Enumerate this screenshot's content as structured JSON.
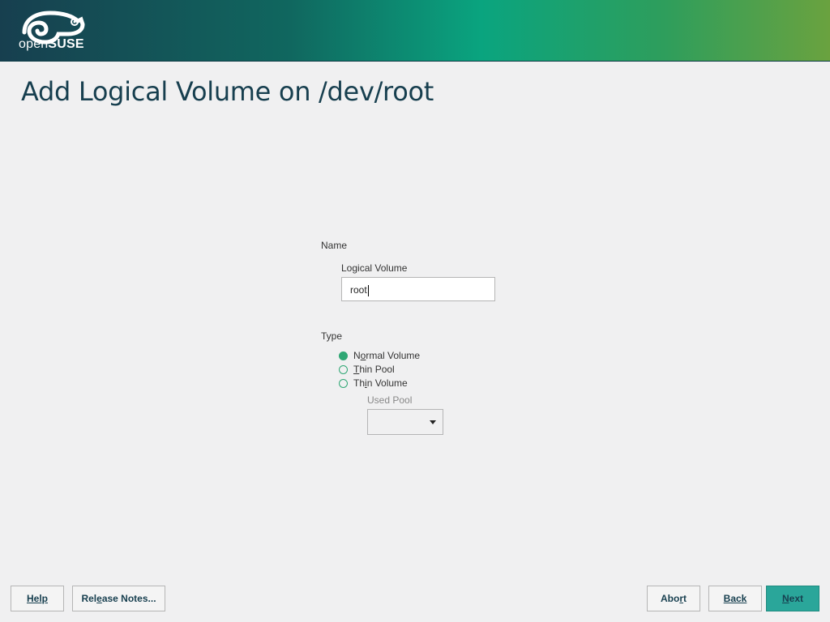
{
  "header": {
    "logo_prefix": "open",
    "logo_brand": "SUSE",
    "logo_icon": "chameleon-icon"
  },
  "title": "Add Logical Volume on /dev/root",
  "name_section": {
    "label": "Name",
    "field_label": "Logical Volume",
    "value": "root"
  },
  "type_section": {
    "label": "Type",
    "options": [
      {
        "label": "Normal Volume",
        "checked": true
      },
      {
        "label": "Thin Pool",
        "checked": false
      },
      {
        "label": "Thin Volume",
        "checked": false
      }
    ],
    "pool_label": "Used Pool",
    "pool_value": ""
  },
  "buttons": {
    "help": "Help",
    "release_notes": "Release Notes...",
    "abort": "Abort",
    "back": "Back",
    "next": "Next"
  },
  "colors": {
    "accent": "#2fa774",
    "next_button": "#2aa69a",
    "title": "#173f4f"
  }
}
